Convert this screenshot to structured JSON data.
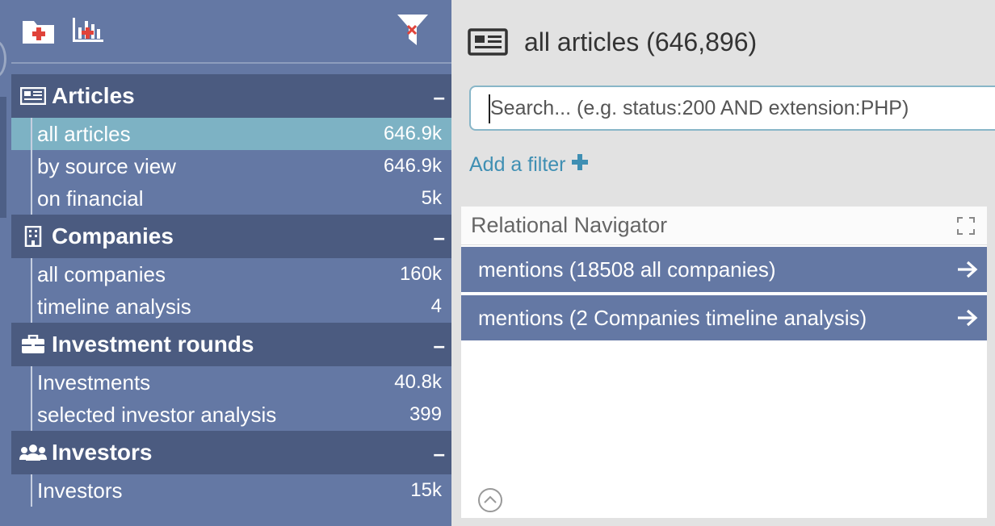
{
  "toolbar": {
    "icons": [
      "new-folder-icon",
      "add-chart-icon",
      "clear-filter-icon"
    ]
  },
  "sidebar": {
    "sections": [
      {
        "title": "Articles",
        "icon": "newspaper-icon",
        "collapse": "–",
        "items": [
          {
            "label": "all articles",
            "count": "646.9k"
          },
          {
            "label": "by source view",
            "count": "646.9k"
          },
          {
            "label": "on financial",
            "count": "5k"
          }
        ]
      },
      {
        "title": "Companies",
        "icon": "building-icon",
        "collapse": "–",
        "items": [
          {
            "label": "all companies",
            "count": "160k"
          },
          {
            "label": "timeline analysis",
            "count": "4"
          }
        ]
      },
      {
        "title": "Investment rounds",
        "icon": "briefcase-icon",
        "collapse": "–",
        "items": [
          {
            "label": "Investments",
            "count": "40.8k"
          },
          {
            "label": "selected investor analysis",
            "count": "399"
          }
        ]
      },
      {
        "title": "Investors",
        "icon": "users-icon",
        "collapse": "–",
        "items": [
          {
            "label": "Investors",
            "count": "15k"
          }
        ]
      }
    ]
  },
  "main": {
    "title": "all articles (646,896)",
    "title_icon": "newspaper-icon",
    "search_placeholder": "Search... (e.g. status:200 AND extension:PHP)",
    "add_filter": "Add a filter",
    "panel": {
      "title": "Relational Navigator",
      "rows": [
        "mentions (18508 all companies)",
        "mentions (2 Companies timeline analysis)"
      ]
    }
  },
  "colors": {
    "sidebar": "#6478a4",
    "section_header": "#4b5b80",
    "active_item": "#7db2c4",
    "link": "#3f8fb3",
    "accent_red": "#e0433a"
  }
}
